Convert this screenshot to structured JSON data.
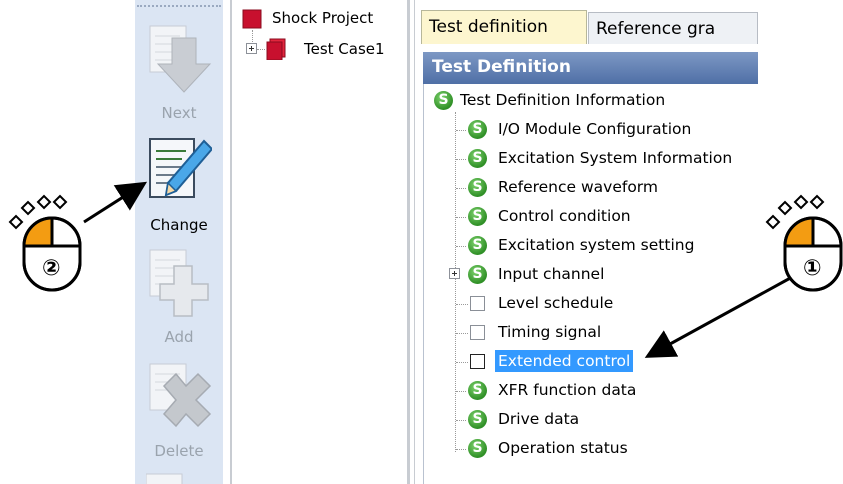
{
  "toolbar": {
    "buttons": [
      {
        "label": "Next",
        "enabled": false
      },
      {
        "label": "Change",
        "enabled": true
      },
      {
        "label": "Add",
        "enabled": false
      },
      {
        "label": "Delete",
        "enabled": false
      }
    ]
  },
  "project_tree": {
    "project": "Shock Project",
    "test_case": "Test Case1"
  },
  "tabs": [
    "Test definition",
    "Reference gra"
  ],
  "panel": {
    "title": "Test Definition",
    "items": [
      {
        "label": "Test Definition Information",
        "icon": "s-icon"
      },
      {
        "label": "I/O Module Configuration",
        "icon": "s-icon"
      },
      {
        "label": "Excitation System Information",
        "icon": "s-icon"
      },
      {
        "label": "Reference waveform",
        "icon": "s-icon"
      },
      {
        "label": "Control condition",
        "icon": "s-icon"
      },
      {
        "label": "Excitation system setting",
        "icon": "s-icon"
      },
      {
        "label": "Input channel",
        "icon": "s-icon"
      },
      {
        "label": "Level schedule",
        "icon": "checkbox"
      },
      {
        "label": "Timing signal",
        "icon": "checkbox"
      },
      {
        "label": "Extended control",
        "icon": "checkbox",
        "selected": true
      },
      {
        "label": "XFR function data",
        "icon": "s-icon"
      },
      {
        "label": "Drive data",
        "icon": "s-icon"
      },
      {
        "label": "Operation status",
        "icon": "s-icon"
      }
    ]
  },
  "annotations": {
    "mouse_left_step": "②",
    "mouse_right_step": "①"
  },
  "colors": {
    "toolbar_bg": "#dbe5f3",
    "header_bg": "#5f7fb5",
    "selection": "#3399ff",
    "mouse_orange": "#f39c12",
    "s_icon_green": "#3a9d2f"
  }
}
